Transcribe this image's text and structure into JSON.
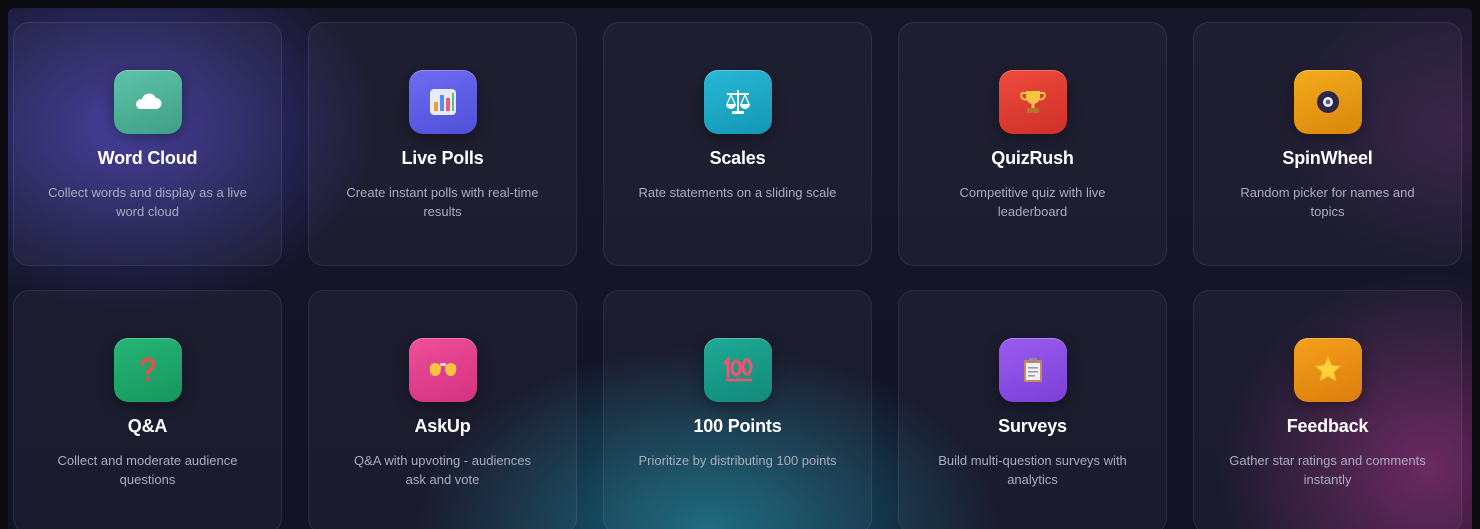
{
  "activities": [
    {
      "title": "Word Cloud",
      "description": "Collect words and display as a live word cloud",
      "icon": "cloud-icon",
      "color_start": "#5ec4a6",
      "color_end": "#3e9f86"
    },
    {
      "title": "Live Polls",
      "description": "Create instant polls with real-time results",
      "icon": "bar-chart-icon",
      "color_start": "#6d6cf2",
      "color_end": "#4f4fd8"
    },
    {
      "title": "Scales",
      "description": "Rate statements on a sliding scale",
      "icon": "scales-icon",
      "color_start": "#28b8d6",
      "color_end": "#1397b5"
    },
    {
      "title": "QuizRush",
      "description": "Competitive quiz with live leaderboard",
      "icon": "trophy-icon",
      "color_start": "#ee4b3c",
      "color_end": "#cf2f28"
    },
    {
      "title": "SpinWheel",
      "description": "Random picker for names and topics",
      "icon": "spin-wheel-icon",
      "color_start": "#f4ab1c",
      "color_end": "#d9870b"
    },
    {
      "title": "Q&A",
      "description": "Collect and moderate audience questions",
      "icon": "question-mark-icon",
      "color_start": "#27b577",
      "color_end": "#16965e"
    },
    {
      "title": "AskUp",
      "description": "Q&A with upvoting - audiences ask and vote",
      "icon": "raising-hands-icon",
      "color_start": "#ef4f9a",
      "color_end": "#d2327e"
    },
    {
      "title": "100 Points",
      "description": "Prioritize by distributing 100 points",
      "icon": "hundred-points-icon",
      "color_start": "#1fa996",
      "color_end": "#128a7a"
    },
    {
      "title": "Surveys",
      "description": "Build multi-question surveys with analytics",
      "icon": "clipboard-icon",
      "color_start": "#9a5cf0",
      "color_end": "#7c3fd6"
    },
    {
      "title": "Feedback",
      "description": "Gather star ratings and comments instantly",
      "icon": "star-icon",
      "color_start": "#f5a01c",
      "color_end": "#dc7d0c"
    }
  ]
}
